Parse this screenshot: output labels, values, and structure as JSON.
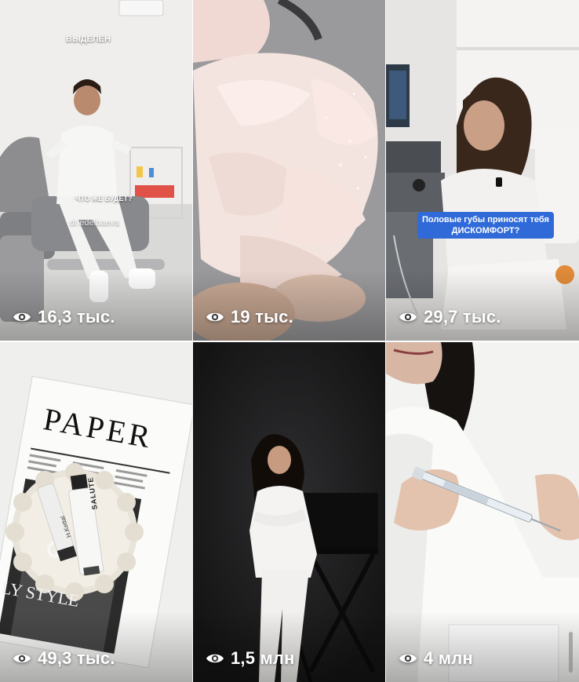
{
  "tiles": [
    {
      "views": "16,3 тыс.",
      "overlay_top": "ВЫДЕЛЕН",
      "overlay_mid": "ЧТО ЖЕ БУДЕТ?",
      "watermark": "dr.edelbaeva"
    },
    {
      "views": "19 тыс."
    },
    {
      "views": "29,7 тыс.",
      "caption_line1": "Половые губы приносят тебя",
      "caption_line2": "ДИСКОМФОРТ?"
    },
    {
      "views": "49,3 тыс.",
      "magazine_title": "PAPER",
      "magazine_bottom": "LY STYLE",
      "product_label": "SALUTE",
      "tube_label": "H.Kettal"
    },
    {
      "views": "1,5 млн"
    },
    {
      "views": "4 млн"
    }
  ],
  "icons": {
    "view_icon": "eye-icon"
  },
  "colors": {
    "caption_bg": "#2f6ad8",
    "view_text": "#ffffff"
  }
}
